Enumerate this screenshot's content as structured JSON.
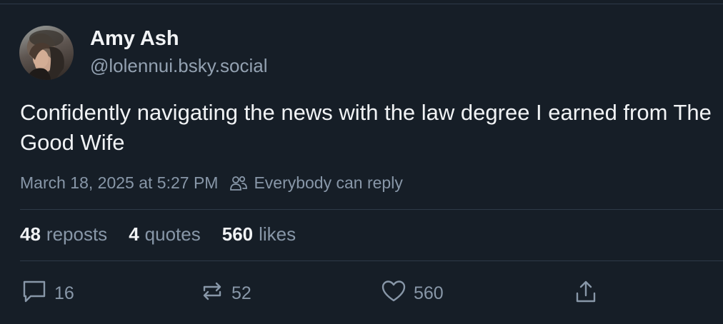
{
  "author": {
    "display_name": "Amy Ash",
    "handle": "@lolennui.bsky.social",
    "avatar_icon": "user-avatar-photo"
  },
  "post": {
    "text": "Confidently navigating the news with the law degree I earned from The Good Wife",
    "timestamp": "March 18, 2025 at 5:27 PM",
    "reply_setting": "Everybody can reply"
  },
  "stats": {
    "reposts_count": "48",
    "reposts_label": "reposts",
    "quotes_count": "4",
    "quotes_label": "quotes",
    "likes_count": "560",
    "likes_label": "likes"
  },
  "actions": {
    "reply_count": "16",
    "repost_count": "52",
    "like_count": "560",
    "icons": [
      "reply-icon",
      "repost-icon",
      "heart-icon",
      "share-icon"
    ]
  },
  "colors": {
    "background": "#161e27",
    "text_primary": "#f1f3f5",
    "text_secondary": "#8897a8",
    "divider": "#2e3a48"
  }
}
